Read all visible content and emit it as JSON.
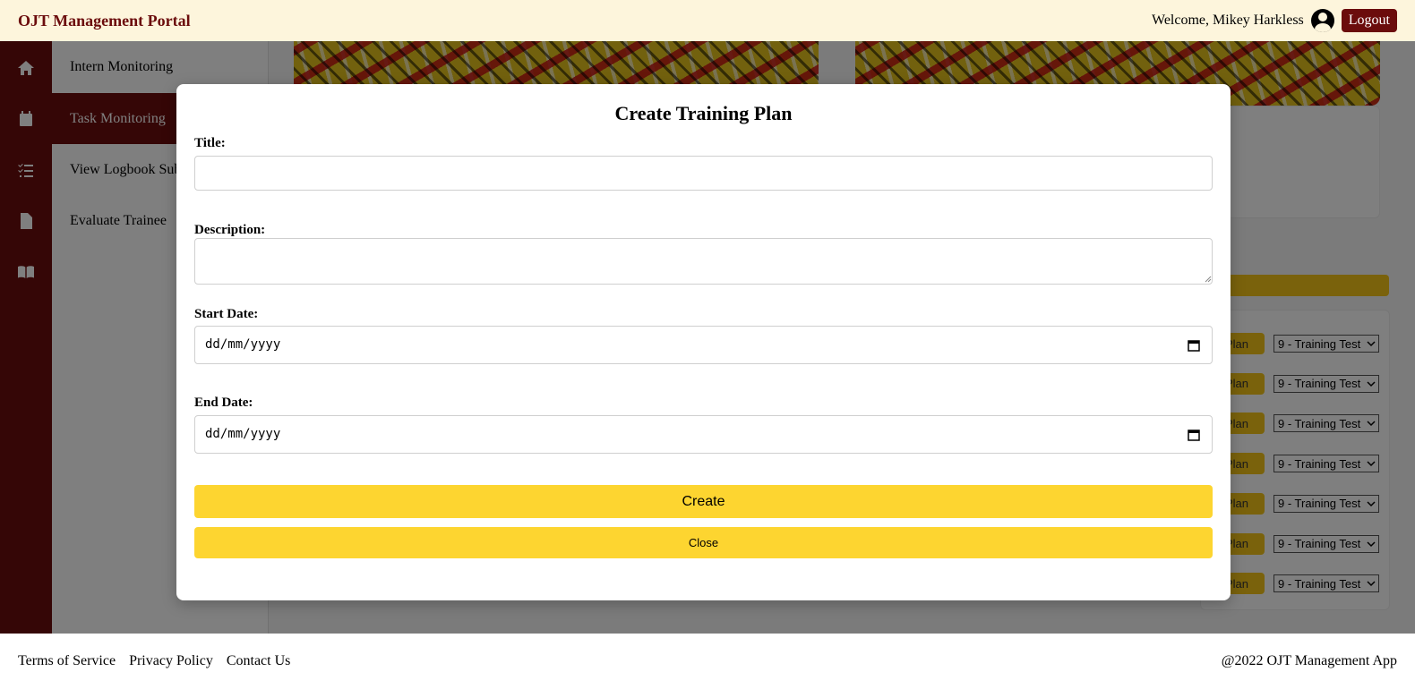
{
  "header": {
    "brand": "OJT Management Portal",
    "welcome": "Welcome, Mikey Harkless",
    "user_icon": "user-circle-icon",
    "logout_label": "Logout"
  },
  "rail": {
    "icons": [
      "home-icon",
      "calendar-icon",
      "checklist-icon",
      "document-icon",
      "book-icon"
    ]
  },
  "sidebar": {
    "items": [
      {
        "label": "Intern Monitoring",
        "active": false
      },
      {
        "label": "Task Monitoring",
        "active": true
      },
      {
        "label": "View Logbook Submissions",
        "active": false
      },
      {
        "label": "Evaluate Trainee",
        "active": false
      }
    ]
  },
  "background_rows": {
    "button_label": "Plan",
    "select_value": "9 - Training Test",
    "count": 7
  },
  "modal": {
    "title": "Create Training Plan",
    "title_label": "Title:",
    "title_value": "",
    "description_label": "Description:",
    "description_value": "",
    "start_date_label": "Start Date:",
    "start_date_placeholder": "dd/mm/yyyy",
    "end_date_label": "End Date:",
    "end_date_placeholder": "dd/mm/yyyy",
    "create_label": "Create",
    "close_label": "Close"
  },
  "footer": {
    "links": [
      "Terms of Service",
      "Privacy Policy",
      "Contact Us"
    ],
    "copyright": "@2022 OJT Management App"
  },
  "colors": {
    "brand": "#6b0c0c",
    "header_bg": "#fdf5dc",
    "button_yellow": "#fdd530",
    "overlay": "rgba(0,0,0,0.5)"
  }
}
